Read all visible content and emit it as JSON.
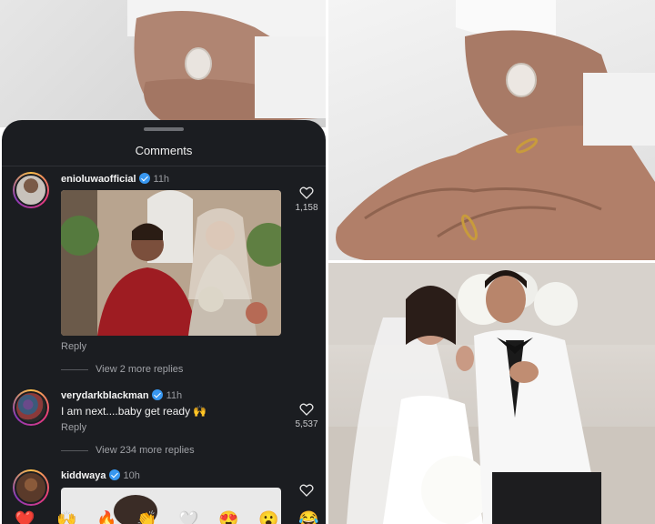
{
  "comments_panel": {
    "title": "Comments",
    "comments": [
      {
        "username": "enioluwaofficial",
        "time": "11h",
        "reply_label": "Reply",
        "like_count": "1,158",
        "view_replies": "View 2 more replies"
      },
      {
        "username": "verydarkblackman",
        "time": "11h",
        "text": "I am next....baby get ready 🙌",
        "reply_label": "Reply",
        "like_count": "5,537",
        "view_replies": "View 234 more replies"
      },
      {
        "username": "kiddwaya",
        "time": "10h"
      }
    ]
  },
  "emoji_bar": [
    "❤️",
    "🙌",
    "🔥",
    "👏",
    "🤍",
    "😍",
    "😮",
    "😂"
  ],
  "colors": {
    "panel_bg": "#1b1d21",
    "verified": "#3897f0",
    "story_ring": "#e93a7a"
  }
}
